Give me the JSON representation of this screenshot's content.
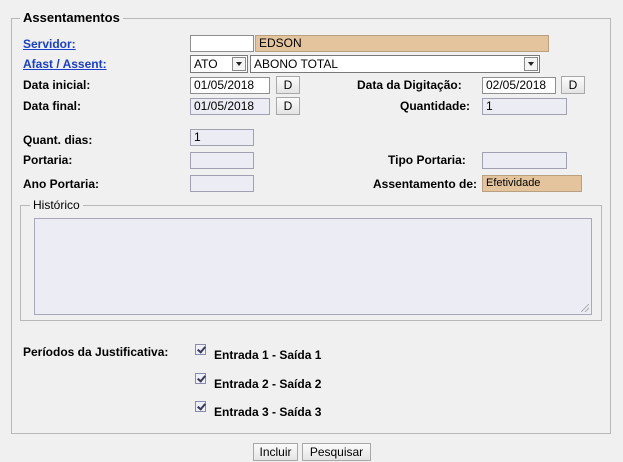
{
  "fieldset": {
    "legend": "Assentamentos"
  },
  "servidor": {
    "label": "Servidor:",
    "code": "",
    "name": "EDSON"
  },
  "afast": {
    "label": "Afast / Assent:",
    "type": "ATO",
    "value": "ABONO TOTAL"
  },
  "data_inicial": {
    "label": "Data inicial:",
    "value": "01/05/2018",
    "button": "D"
  },
  "data_digitacao": {
    "label": "Data da Digitação:",
    "value": "02/05/2018",
    "button": "D"
  },
  "data_final": {
    "label": "Data final:",
    "value": "01/05/2018",
    "button": "D"
  },
  "quantidade": {
    "label": "Quantidade:",
    "value": "1"
  },
  "quant_dias": {
    "label": "Quant. dias:",
    "value": "1"
  },
  "portaria": {
    "label": "Portaria:",
    "value": ""
  },
  "tipo_portaria": {
    "label": "Tipo Portaria:",
    "value": ""
  },
  "ano_portaria": {
    "label": "Ano Portaria:",
    "value": ""
  },
  "assentamento_de": {
    "label": "Assentamento de:",
    "value": "Efetividade"
  },
  "historico": {
    "legend": "Histórico",
    "value": ""
  },
  "periodos": {
    "label": "Períodos da Justificativa:",
    "items": [
      {
        "label": "Entrada 1 - Saída 1",
        "checked": true
      },
      {
        "label": "Entrada 2 - Saída 2",
        "checked": true
      },
      {
        "label": "Entrada 3 - Saída 3",
        "checked": true
      }
    ]
  },
  "buttons": {
    "incluir": "Incluir",
    "pesquisar": "Pesquisar"
  },
  "colors": {
    "link": "#1a3fc8",
    "highlight_field": "#e4c49c",
    "readonly_field": "#ececf4"
  }
}
